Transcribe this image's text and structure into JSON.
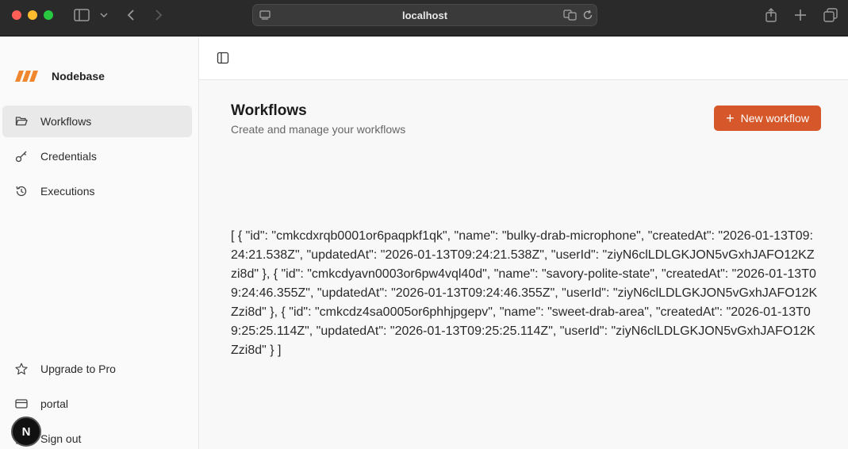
{
  "browser": {
    "address": "localhost"
  },
  "sidebar": {
    "brand_name": "Nodebase",
    "nav": [
      {
        "label": "Workflows",
        "icon": "folder-open-icon",
        "active": true
      },
      {
        "label": "Credentials",
        "icon": "key-icon",
        "active": false
      },
      {
        "label": "Executions",
        "icon": "history-icon",
        "active": false
      }
    ],
    "bottom": [
      {
        "label": "Upgrade to Pro",
        "icon": "star-icon"
      },
      {
        "label": "portal",
        "icon": "credit-card-icon"
      },
      {
        "label": "Sign out",
        "icon": "log-out-icon"
      }
    ],
    "avatar_letter": "N"
  },
  "main": {
    "title": "Workflows",
    "subtitle": "Create and manage your workflows",
    "new_button_label": "New workflow",
    "json_output": "[ { \"id\": \"cmkcdxrqb0001or6paqpkf1qk\", \"name\": \"bulky-drab-microphone\", \"createdAt\": \"2026-01-13T09:24:21.538Z\", \"updatedAt\": \"2026-01-13T09:24:21.538Z\", \"userId\": \"ziyN6clLDLGKJON5vGxhJAFO12KZzi8d\" }, { \"id\": \"cmkcdyavn0003or6pw4vql40d\", \"name\": \"savory-polite-state\", \"createdAt\": \"2026-01-13T09:24:46.355Z\", \"updatedAt\": \"2026-01-13T09:24:46.355Z\", \"userId\": \"ziyN6clLDLGKJON5vGxhJAFO12KZzi8d\" }, { \"id\": \"cmkcdz4sa0005or6phhjpgepv\", \"name\": \"sweet-drab-area\", \"createdAt\": \"2026-01-13T09:25:25.114Z\", \"updatedAt\": \"2026-01-13T09:25:25.114Z\", \"userId\": \"ziyN6clLDLGKJON5vGxhJAFO12KZzi8d\" } ]"
  },
  "colors": {
    "accent": "#d5572a",
    "logo_orange": "#f0872f"
  }
}
